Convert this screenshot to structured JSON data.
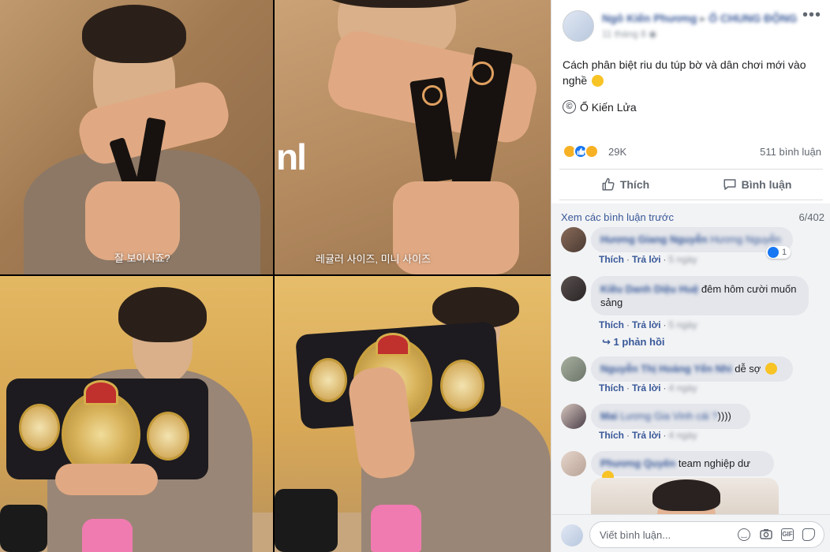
{
  "photos": {
    "top_left_subtitle": "잘 보이시죠?",
    "top_right_subtitle": "레귤러 사이즈, 미니 사이즈",
    "top_right_logo": "nl"
  },
  "post": {
    "author": "Ngô Kiến Phương",
    "group": "Ổ CHUNG ĐỘNG",
    "time": "11 tháng 8",
    "text": "Cách phân biệt riu du túp bờ và dân chơi mới vào nghề",
    "copyright_symbol": "©",
    "copyright_text": "Ổ Kiến Lửa",
    "reaction_count": "29K",
    "comment_count": "511 bình luận",
    "more_glyph": "•••"
  },
  "actions": {
    "like_label": "Thích",
    "comment_label": "Bình luận"
  },
  "comments_section": {
    "view_previous": "Xem các bình luận trước",
    "pager": "6/402",
    "like_label": "Thích",
    "reply_label": "Trả lời",
    "separator": "·",
    "replies_label": "1 phản hồi",
    "reply_arrow": "↪",
    "items": [
      {
        "author": "Hương Giang Nguyễn",
        "text": "Hương Nguyễn",
        "time": "5 ngày",
        "likes": "1"
      },
      {
        "author": "Kiều Danh Diệu Huệ",
        "text": "đêm hôm cười muốn sảng",
        "time": "5 ngày"
      },
      {
        "author": "Nguyễn Thị Hoàng Yến Nhi",
        "text": "dễ sợ",
        "time": "4 ngày"
      },
      {
        "author": "Mai",
        "text": "Lương Gia Vinh cái ?",
        "text_suffix": "))))",
        "time": "4 ngày"
      },
      {
        "author": "Phương Quyên",
        "text": "team nghiệp dư"
      }
    ]
  },
  "composer": {
    "placeholder": "Viết bình luận..."
  },
  "icons": {
    "like": "thumbs-up-icon",
    "comment": "speech-bubble-icon",
    "emoji": "smiley-icon",
    "camera": "camera-icon",
    "gif": "gif-icon",
    "sticker": "sticker-icon"
  },
  "colors": {
    "link_blue": "#385898",
    "facebook_blue": "#1877f2",
    "muted_text": "#606770",
    "comment_bg": "#f2f3f5"
  }
}
